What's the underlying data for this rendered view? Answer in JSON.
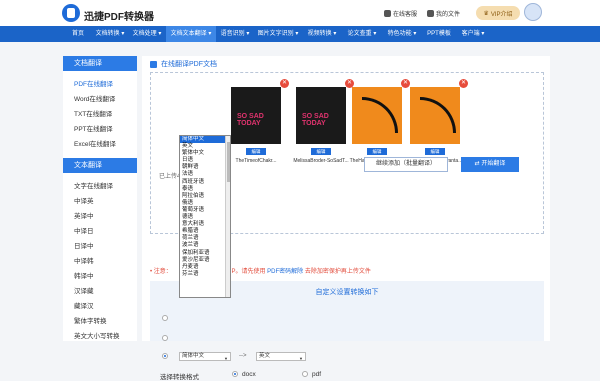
{
  "header": {
    "brand": "迅捷PDF转换器",
    "online_service": "在线客服",
    "my_files": "我的文件",
    "vip": "VIP介绍"
  },
  "nav": [
    "首页",
    "文档转换",
    "文档处理",
    "文档文本翻译",
    "语音识别",
    "图片文字识别",
    "视频转换",
    "论文查重",
    "特色功能",
    "PPT模板",
    "客户端"
  ],
  "sidebar": {
    "doc_translate": "文档翻译",
    "doc_items": [
      "PDF在线翻译",
      "Word在线翻译",
      "TXT在线翻译",
      "PPT在线翻译",
      "Excel在线翻译"
    ],
    "text_translate": "文本翻译",
    "text_items": [
      "文字在线翻译",
      "中译英",
      "英译中",
      "中译日",
      "日译中",
      "中译韩",
      "韩译中",
      "汉译藏",
      "藏译汉",
      "繁体字转换",
      "英文大小写转换"
    ]
  },
  "main": {
    "title": "在线翻译PDF文档",
    "files": [
      {
        "name": "TheTimeofChakr...",
        "cover": "SO SAD TODAY",
        "style": "dark"
      },
      {
        "name": "MelissaBroder-SoSadT...",
        "cover": "SO SAD TODAY",
        "style": "dark"
      },
      {
        "name": "TheHappinessAdvanta...",
        "cover": "",
        "style": "orange"
      },
      {
        "name": "TheHappinessAdvanta...",
        "cover": "",
        "style": "orange"
      }
    ],
    "edit": "编辑",
    "upload_status": "已上传4",
    "add_button": "继续添加（批量翻译）",
    "start_button": "开始翻译",
    "notice_prefix": "• 注意：",
    "notice_mid": "P。请先使用",
    "notice_link": "PDF密码解除",
    "notice_suffix": "去除加密保护再上传文件",
    "settings_title": "自定义设置转换如下",
    "source_lang": "简体中文",
    "arrow": "-->",
    "target_lang": "英文",
    "format_label": "选择转换格式",
    "fmt_docx": "docx",
    "fmt_pdf": "pdf"
  },
  "dropdown": {
    "items": [
      "简体中文",
      "英文",
      "繁体中文",
      "日语",
      "朝鲜语",
      "法语",
      "西班牙语",
      "泰语",
      "阿拉伯语",
      "俄语",
      "葡萄牙语",
      "德语",
      "意大利语",
      "希腊语",
      "荷兰语",
      "波兰语",
      "保加利亚语",
      "爱沙尼亚语",
      "丹麦语",
      "芬兰语"
    ],
    "selected_index": 0
  }
}
